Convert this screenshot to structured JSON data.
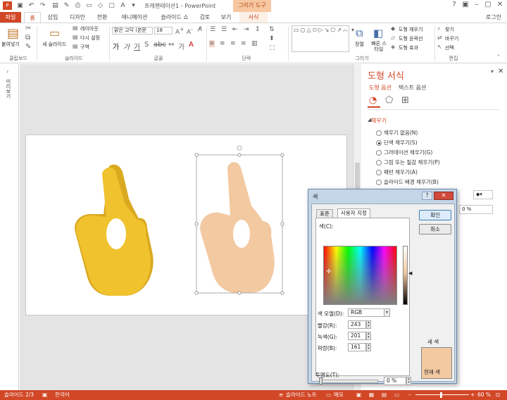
{
  "title_bar": {
    "title": "프레젠테이션1 - PowerPoint",
    "context_group": "그리기 도구"
  },
  "tabs": [
    {
      "label": "파일"
    },
    {
      "label": "홈"
    },
    {
      "label": "삽입"
    },
    {
      "label": "디자인"
    },
    {
      "label": "전환"
    },
    {
      "label": "애니메이션"
    },
    {
      "label": "슬라이드 쇼"
    },
    {
      "label": "검토"
    },
    {
      "label": "보기"
    },
    {
      "label": "서식"
    }
  ],
  "login": "로그인",
  "ribbon": {
    "clipboard": {
      "label": "클립보드",
      "paste": "붙여넣기"
    },
    "slides": {
      "label": "슬라이드",
      "new_slide": "새 슬라이드",
      "layout": "레이아웃",
      "reset": "다시 설정",
      "section": "구역"
    },
    "font": {
      "label": "글꼴",
      "font_name": "맑은 고딕 (본문",
      "font_size": "18"
    },
    "paragraph": {
      "label": "단락"
    },
    "drawing": {
      "label": "그리기",
      "arrange": "정렬",
      "quick_styles": "빠른 스타일",
      "shape_fill": "도형 채우기",
      "shape_outline": "도형 윤곽선",
      "shape_effects": "도형 효과"
    },
    "editing": {
      "label": "편집",
      "find": "찾기",
      "replace": "바꾸기",
      "select": "선택"
    }
  },
  "left_pane": {
    "label": "미리보기"
  },
  "format_pane": {
    "title": "도형 서식",
    "tabs": [
      "도형 옵션",
      "텍스트 옵션"
    ],
    "section": "채우기",
    "fill_options": [
      {
        "label": "채우기 없음(N)",
        "selected": false
      },
      {
        "label": "단색 채우기(S)",
        "selected": true
      },
      {
        "label": "그라데이션 채우기(G)",
        "selected": false
      },
      {
        "label": "그림 또는 질감 채우기(P)",
        "selected": false
      },
      {
        "label": "패턴 채우기(A)",
        "selected": false
      },
      {
        "label": "슬라이드 배경 채우기(B)",
        "selected": false
      }
    ],
    "transparency_value": "0 %"
  },
  "color_dialog": {
    "title": "색",
    "tabs": [
      "표준",
      "사용자 지정"
    ],
    "active_tab": "사용자 지정",
    "colors_label": "색(C):",
    "model_label": "색 모델(D):",
    "model_value": "RGB",
    "red_label": "빨강(R):",
    "red": "243",
    "green_label": "녹색(G):",
    "green": "201",
    "blue_label": "파랑(B):",
    "blue": "161",
    "transparency_label": "투명도(T):",
    "transparency": "0 %",
    "ok": "확인",
    "cancel": "취소",
    "new_label": "새 색",
    "current_label": "현재 색",
    "swatch_color": "#F3C9A1"
  },
  "status_bar": {
    "slide": "슬라이드 2/3",
    "language": "한국어",
    "notes": "슬라이드 노트",
    "comments": "메모",
    "zoom": "60 %"
  },
  "colors": {
    "accent": "#D24726",
    "emoji_yellow": "#F0C22E",
    "emoji_skin": "#F3C9A1"
  }
}
